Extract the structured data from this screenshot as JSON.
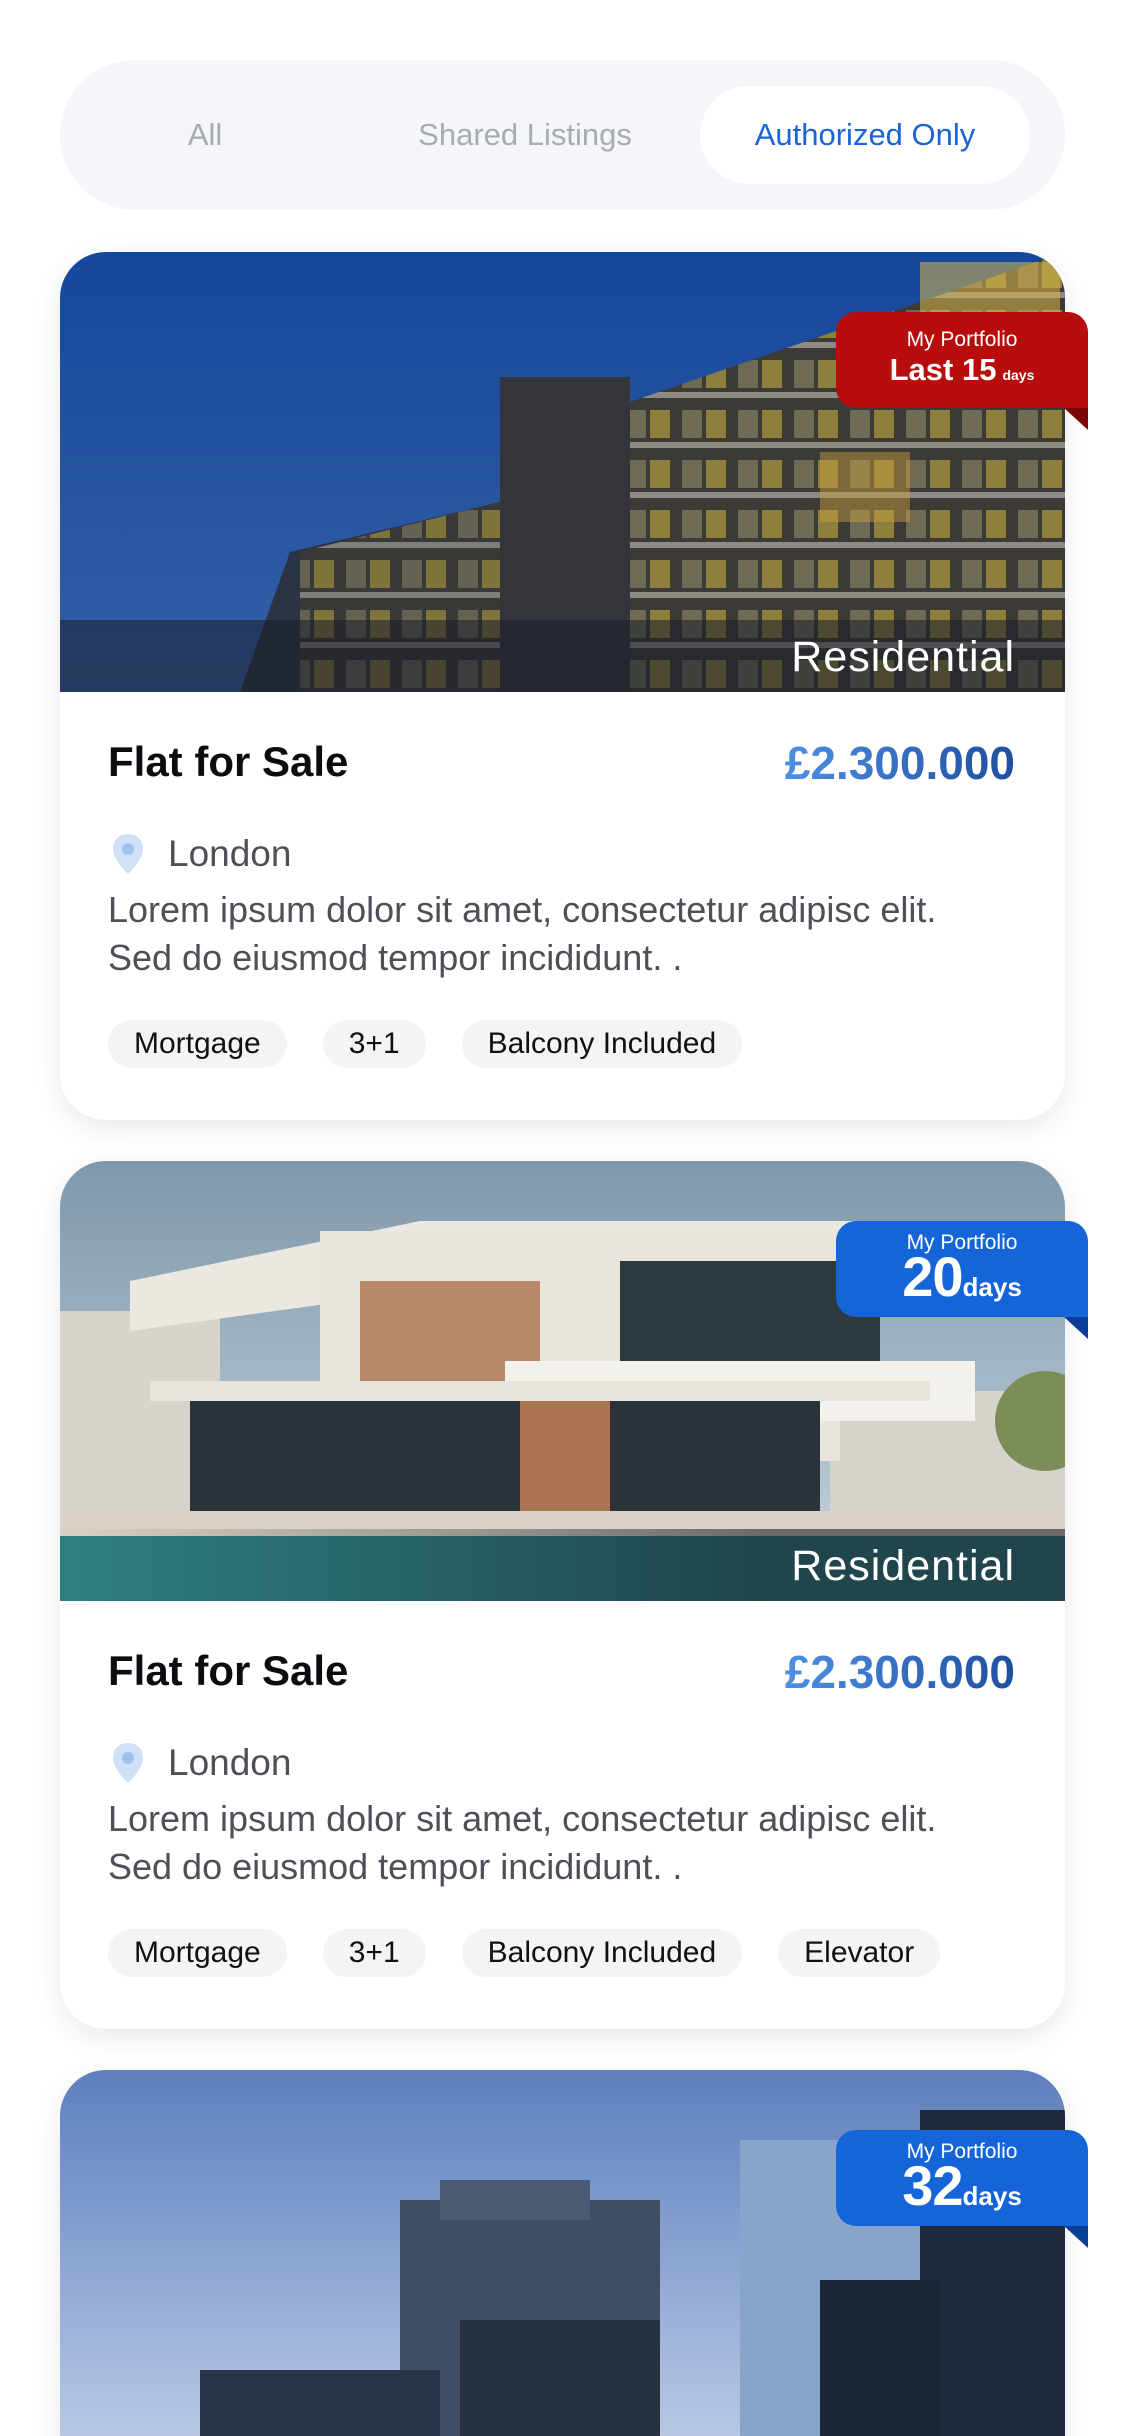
{
  "tabs": [
    {
      "label": "All",
      "active": false
    },
    {
      "label": "Shared Listings",
      "active": false
    },
    {
      "label": "Authorized Only",
      "active": true
    }
  ],
  "listings": [
    {
      "category": "Residential",
      "badge": {
        "title": "My Portfolio",
        "value": "Last 15",
        "unit": "days",
        "color": "#b80d0d"
      },
      "title": "Flat for Sale",
      "price": "£2.300.000",
      "location": "London",
      "description": "Lorem ipsum dolor sit amet, consectetur adipisc elit. Sed do eiusmod tempor incididunt. .",
      "tags": [
        "Mortgage",
        "3+1",
        "Balcony Included"
      ]
    },
    {
      "category": "Residential",
      "badge": {
        "title": "My Portfolio",
        "value": "20",
        "unit": "days",
        "color": "#1565d8"
      },
      "title": "Flat for Sale",
      "price": "£2.300.000",
      "location": "London",
      "description": "Lorem ipsum dolor sit amet, consectetur adipisc elit. Sed do eiusmod tempor incididunt. .",
      "tags": [
        "Mortgage",
        "3+1",
        "Balcony Included",
        "Elevator"
      ]
    },
    {
      "badge": {
        "title": "My Portfolio",
        "value": "32",
        "unit": "days",
        "color": "#1565d8"
      }
    }
  ],
  "colors": {
    "accent": "#1a63d8",
    "price_start": "#4f8fe6",
    "price_end": "#1d4f9e"
  }
}
